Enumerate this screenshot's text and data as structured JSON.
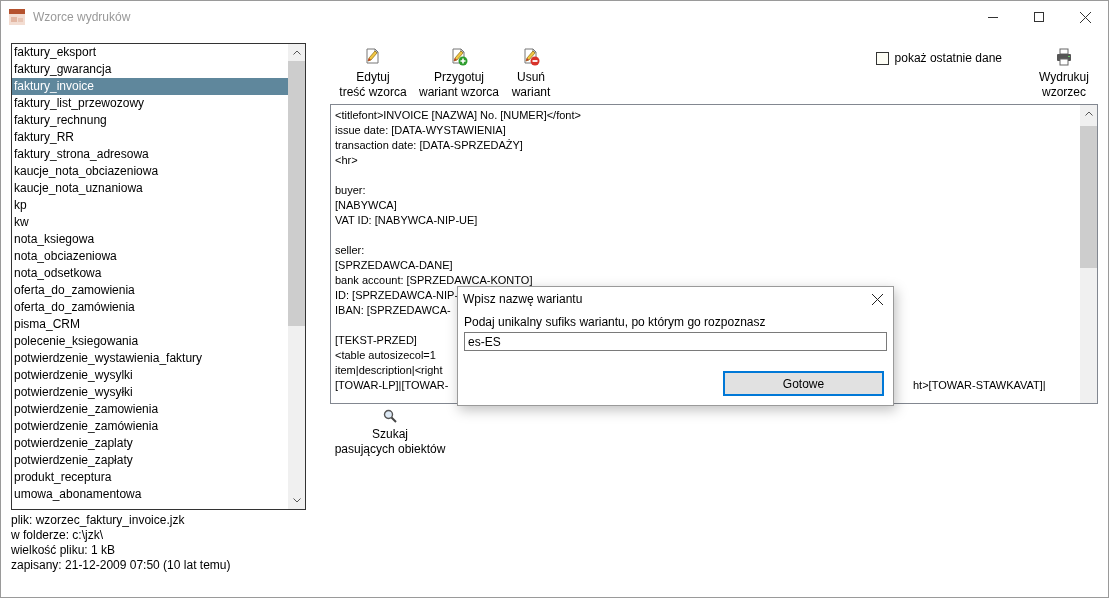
{
  "window": {
    "title": "Wzorce wydruków"
  },
  "templates": [
    {
      "label": "faktury_eksport",
      "selected": false
    },
    {
      "label": "faktury_gwarancja",
      "selected": false
    },
    {
      "label": "faktury_invoice",
      "selected": true
    },
    {
      "label": "faktury_list_przewozowy",
      "selected": false
    },
    {
      "label": "faktury_rechnung",
      "selected": false
    },
    {
      "label": "faktury_RR",
      "selected": false
    },
    {
      "label": "faktury_strona_adresowa",
      "selected": false
    },
    {
      "label": "kaucje_nota_obciazeniowa",
      "selected": false
    },
    {
      "label": "kaucje_nota_uznaniowa",
      "selected": false
    },
    {
      "label": "kp",
      "selected": false
    },
    {
      "label": "kw",
      "selected": false
    },
    {
      "label": "nota_ksiegowa",
      "selected": false
    },
    {
      "label": "nota_obciazeniowa",
      "selected": false
    },
    {
      "label": "nota_odsetkowa",
      "selected": false
    },
    {
      "label": "oferta_do_zamowienia",
      "selected": false
    },
    {
      "label": "oferta_do_zamówienia",
      "selected": false
    },
    {
      "label": "pisma_CRM",
      "selected": false
    },
    {
      "label": "polecenie_ksiegowania",
      "selected": false
    },
    {
      "label": "potwierdzenie_wystawienia_faktury",
      "selected": false
    },
    {
      "label": "potwierdzenie_wysylki",
      "selected": false
    },
    {
      "label": "potwierdzenie_wysyłki",
      "selected": false
    },
    {
      "label": "potwierdzenie_zamowienia",
      "selected": false
    },
    {
      "label": "potwierdzenie_zamówienia",
      "selected": false
    },
    {
      "label": "potwierdzenie_zaplaty",
      "selected": false
    },
    {
      "label": "potwierdzenie_zapłaty",
      "selected": false
    },
    {
      "label": "produkt_receptura",
      "selected": false
    },
    {
      "label": "umowa_abonamentowa",
      "selected": false
    }
  ],
  "file_info": [
    "plik: wzorzec_faktury_invoice.jzk",
    "w folderze: c:\\jzk\\",
    "wielkość pliku: 1 kB",
    "zapisany: 21-12-2009 07:50 (10 lat temu)"
  ],
  "toolbar": [
    {
      "kind": "edit",
      "lines": [
        "Edytuj",
        "treść wzorca"
      ]
    },
    {
      "kind": "add",
      "lines": [
        "Przygotuj",
        "wariant wzorca"
      ]
    },
    {
      "kind": "remove",
      "lines": [
        "Usuń",
        "wariant"
      ]
    }
  ],
  "show_last_data": {
    "label": "pokaż ostatnie dane",
    "checked": false
  },
  "print_button": {
    "lines": [
      "Wydrukuj",
      "wzorzec"
    ]
  },
  "editor": {
    "blocks": [
      [
        {
          "text": "<titlefont>INVOICE [NAZWA] No. [NUMER]</font>"
        },
        {
          "text": "issue date: [DATA-WYSTAWIENIA]"
        },
        {
          "text": "transaction date: [DATA-SPRZEDAŻY]"
        },
        {
          "text": "<hr>"
        }
      ],
      [
        {
          "text": "buyer:"
        },
        {
          "text": "[NABYWCA]"
        },
        {
          "text": "VAT ID: [NABYWCA-NIP-UE]"
        }
      ],
      [
        {
          "text": "seller:"
        },
        {
          "text": "[SPRZEDAWCA-DANE]"
        },
        {
          "text": "bank account: [SPRZEDAWCA-KONTO]"
        },
        {
          "text": "ID: [SPRZEDAWCA-NIP-"
        },
        {
          "text": "IBAN: [SPRZEDAWCA-"
        }
      ],
      [
        {
          "text": "[TEKST-PRZED]"
        },
        {
          "text": "<table autosizecol=1"
        },
        {
          "text": "item|description|<right"
        },
        {
          "text": "[TOWAR-LP]|[TOWAR-",
          "text_right": "ht>[TOWAR-STAWKAVAT]|"
        }
      ]
    ]
  },
  "search_button": {
    "lines": [
      "Szukaj",
      "pasujących obiektów"
    ]
  },
  "dialog": {
    "title": "Wpisz nazwę wariantu",
    "prompt": "Podaj unikalny sufiks wariantu, po którym go rozpoznasz",
    "value": "es-ES",
    "button": "Gotowe"
  }
}
